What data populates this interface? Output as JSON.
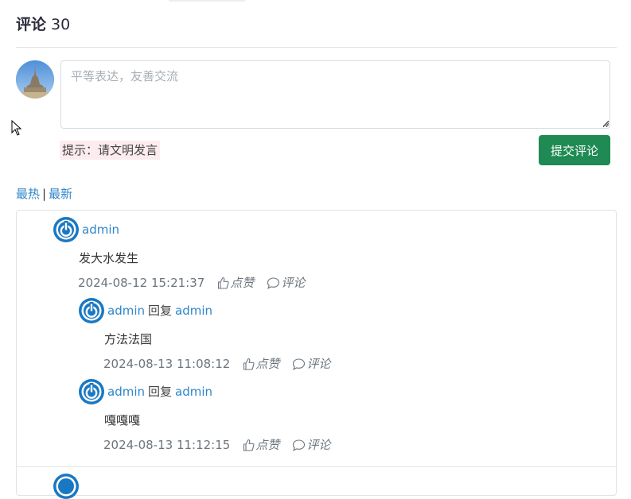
{
  "header": {
    "title": "评论",
    "count": "30"
  },
  "composer": {
    "placeholder": "平等表达，友善交流",
    "hint": "提示：请文明发言",
    "submit_label": "提交评论"
  },
  "sort": {
    "hot": "最热",
    "separator": "|",
    "latest": "最新"
  },
  "comments": [
    {
      "user": "admin",
      "content": "发大水发生",
      "time": "2024-08-12 15:21:37",
      "like_label": "点赞",
      "comment_label": "评论",
      "replies": [
        {
          "user": "admin",
          "reply_word": "回复",
          "reply_to": "admin",
          "content": "方法法国",
          "time": "2024-08-13 11:08:12",
          "like_label": "点赞",
          "comment_label": "评论"
        },
        {
          "user": "admin",
          "reply_word": "回复",
          "reply_to": "admin",
          "content": "嘎嘎嘎",
          "time": "2024-08-13 11:12:15",
          "like_label": "点赞",
          "comment_label": "评论"
        }
      ]
    }
  ],
  "colors": {
    "accent_link": "#2f86c9",
    "submit_button": "#1f8a53",
    "hint_background": "#fdecef",
    "avatar_logo": "#1a78c2"
  },
  "icons": {
    "avatar": "power-logo-icon",
    "like": "thumbs-up-icon",
    "comment": "speech-bubble-icon"
  }
}
